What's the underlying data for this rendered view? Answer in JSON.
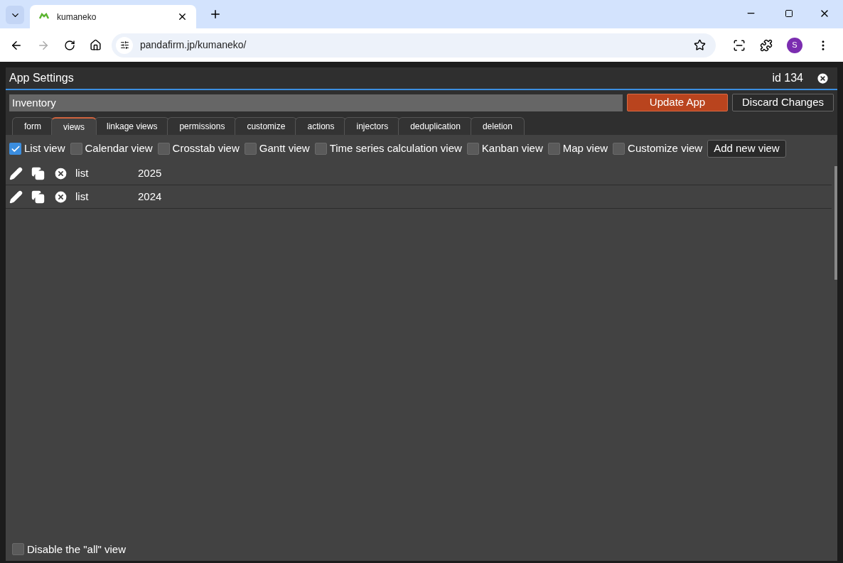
{
  "browser": {
    "tab_title": "kumaneko",
    "url": "pandafirm.jp/kumaneko/",
    "profile_initial": "S"
  },
  "dialog": {
    "title": "App Settings",
    "id_label": "id 134",
    "app_name": "Inventory",
    "update_button": "Update App",
    "discard_button": "Discard Changes"
  },
  "tabs": [
    {
      "label": "form",
      "selected": false
    },
    {
      "label": "views",
      "selected": true
    },
    {
      "label": "linkage views",
      "selected": false
    },
    {
      "label": "permissions",
      "selected": false
    },
    {
      "label": "customize",
      "selected": false
    },
    {
      "label": "actions",
      "selected": false
    },
    {
      "label": "injectors",
      "selected": false
    },
    {
      "label": "deduplication",
      "selected": false
    },
    {
      "label": "deletion",
      "selected": false
    }
  ],
  "view_types": [
    {
      "label": "List view",
      "checked": true
    },
    {
      "label": "Calendar view",
      "checked": false
    },
    {
      "label": "Crosstab view",
      "checked": false
    },
    {
      "label": "Gantt view",
      "checked": false
    },
    {
      "label": "Time series calculation view",
      "checked": false
    },
    {
      "label": "Kanban view",
      "checked": false
    },
    {
      "label": "Map view",
      "checked": false
    },
    {
      "label": "Customize view",
      "checked": false
    }
  ],
  "add_view_button": "Add new view",
  "views": [
    {
      "type": "list",
      "name": "2025"
    },
    {
      "type": "list",
      "name": "2024"
    }
  ],
  "disable_all_view": {
    "label": "Disable the \"all\" view",
    "checked": false
  }
}
